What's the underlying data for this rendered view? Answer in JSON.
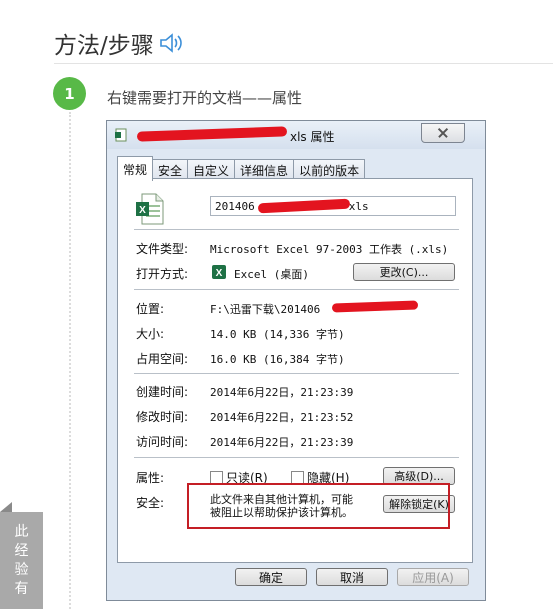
{
  "article": {
    "section_title": "方法/步骤",
    "step_number": "1",
    "step_text": "右键需要打开的文档——属性",
    "side_tab": [
      "此",
      "经",
      "验",
      "有"
    ]
  },
  "dialog": {
    "title_suffix": "xls 属性",
    "tabs": [
      "常规",
      "安全",
      "自定义",
      "详细信息",
      "以前的版本"
    ],
    "active_tab": "常规",
    "file_name_prefix": "201406",
    "file_name_suffix": "xls",
    "fields": {
      "file_type_label": "文件类型:",
      "file_type_value": "Microsoft Excel 97-2003 工作表 (.xls)",
      "open_with_label": "打开方式:",
      "open_with_value": "Excel (桌面)",
      "change_button": "更改(C)...",
      "location_label": "位置:",
      "location_value": "F:\\迅雷下载\\201406",
      "size_label": "大小:",
      "size_value": "14.0 KB (14,336 字节)",
      "disk_size_label": "占用空间:",
      "disk_size_value": "16.0 KB (16,384 字节)",
      "created_label": "创建时间:",
      "created_value": "2014年6月22日，21:23:39",
      "modified_label": "修改时间:",
      "modified_value": "2014年6月22日，21:23:52",
      "accessed_label": "访问时间:",
      "accessed_value": "2014年6月22日，21:23:39",
      "attributes_label": "属性:",
      "readonly_label": "只读(R)",
      "hidden_label": "隐藏(H)",
      "advanced_button": "高级(D)...",
      "security_label": "安全:",
      "security_line1": "此文件来自其他计算机，可能",
      "security_line2": "被阻止以帮助保护该计算机。",
      "unblock_button": "解除锁定(K)"
    },
    "footer": {
      "ok": "确定",
      "cancel": "取消",
      "apply": "应用(A)"
    }
  },
  "colors": {
    "step_green": "#58b947",
    "highlight_red": "#c41e25",
    "dialog_bg": "#dfe8f3"
  }
}
